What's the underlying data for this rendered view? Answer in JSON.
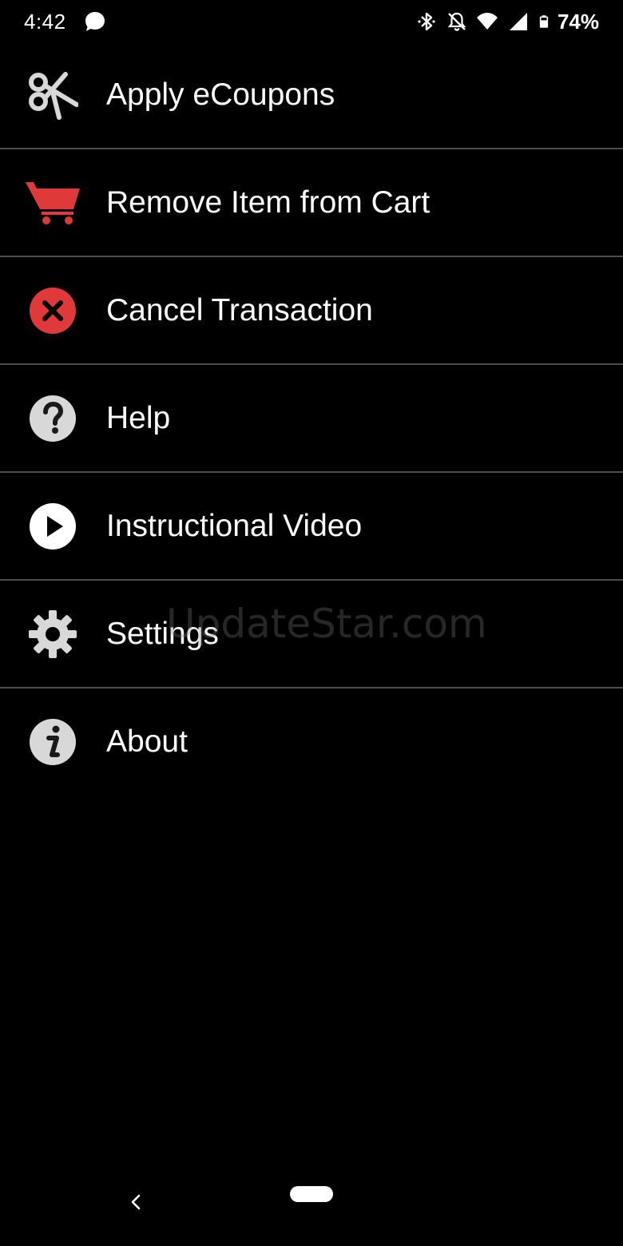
{
  "status_bar": {
    "time": "4:42",
    "battery_percent": "74%",
    "icons": [
      "chat-bubble-icon",
      "bluetooth-icon",
      "notifications-off-icon",
      "wifi-icon",
      "cell-signal-icon",
      "battery-icon"
    ]
  },
  "menu": {
    "items": [
      {
        "label": "Apply eCoupons",
        "icon": "scissors-icon"
      },
      {
        "label": "Remove Item from Cart",
        "icon": "cart-icon"
      },
      {
        "label": "Cancel Transaction",
        "icon": "cancel-icon"
      },
      {
        "label": "Help",
        "icon": "help-icon"
      },
      {
        "label": "Instructional Video",
        "icon": "play-icon"
      },
      {
        "label": "Settings",
        "icon": "gear-icon"
      },
      {
        "label": "About",
        "icon": "info-icon"
      }
    ]
  },
  "watermark": "UpdateStar.com",
  "colors": {
    "background": "#000000",
    "divider": "#4d4d4d",
    "accent_red": "#e0393a",
    "icon_gray": "#d8d8d8"
  }
}
